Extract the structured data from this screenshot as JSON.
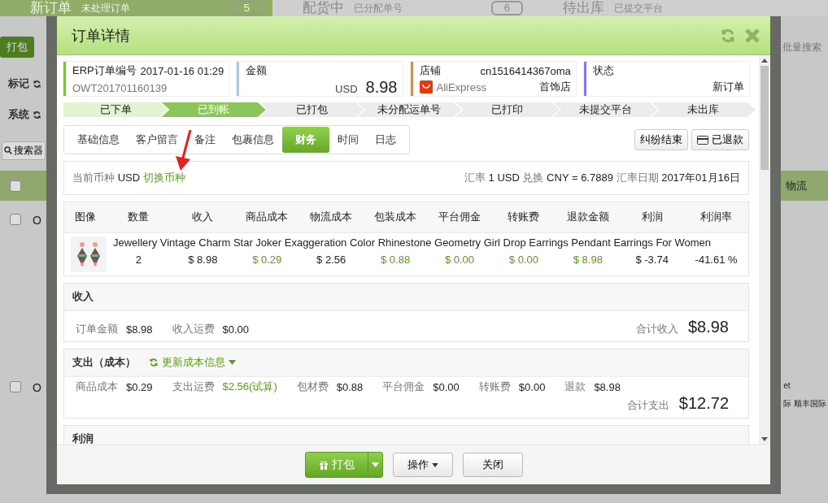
{
  "background": {
    "stats": [
      {
        "title": "新订单",
        "subtitle": "未处理订单",
        "count": "5",
        "selected": true
      },
      {
        "title": "配货中",
        "subtitle": "已分配单号",
        "count": "6",
        "selected": false
      },
      {
        "title": "待出库",
        "subtitle": "已提交平台",
        "selected": false
      }
    ],
    "pack_button": "打包",
    "batch_search": "批量搜索",
    "filters": [
      "标记",
      "系统"
    ],
    "search_button": "搜索器",
    "logistics_header": "物流",
    "header_checked": false,
    "rows": [
      {
        "order": "O",
        "checked": false,
        "logistics": []
      },
      {
        "order": "O",
        "checked": false,
        "logistics": [
          "et",
          "际 顺丰国际"
        ]
      }
    ]
  },
  "dialog": {
    "title": "订单详情",
    "info_cards": [
      {
        "kind": "order",
        "label": "ERP订单编号",
        "value": "2017-01-16 01:29",
        "sub": "OWT201701160139",
        "color": "#7cc04b"
      },
      {
        "kind": "amount",
        "label": "金额",
        "currency": "USD",
        "amount": "8.98",
        "color": "#a9c9e8"
      },
      {
        "kind": "shop",
        "label": "店铺",
        "value": "cn1516414367oma",
        "platform": "AliExpress",
        "sub": "首饰店",
        "color": "#f08a24"
      },
      {
        "kind": "status",
        "label": "状态",
        "sub": "新订单",
        "color": "#8578f0"
      }
    ],
    "steps": [
      {
        "label": "已下单",
        "completed": true,
        "selected": false
      },
      {
        "label": "已到帐",
        "completed": true,
        "selected": true
      },
      {
        "label": "已打包",
        "completed": false,
        "selected": false
      },
      {
        "label": "未分配运单号",
        "completed": false,
        "selected": false
      },
      {
        "label": "已打印",
        "completed": false,
        "selected": false
      },
      {
        "label": "未提交平台",
        "completed": false,
        "selected": false
      },
      {
        "label": "未出库",
        "completed": false,
        "selected": false
      }
    ],
    "tabs": [
      {
        "label": "基础信息",
        "selected": false
      },
      {
        "label": "客户留言",
        "selected": false
      },
      {
        "label": "备注",
        "selected": false
      },
      {
        "label": "包裹信息",
        "selected": false
      },
      {
        "label": "财务",
        "selected": true
      },
      {
        "label": "时间",
        "selected": false
      },
      {
        "label": "日志",
        "selected": false
      }
    ],
    "actions": [
      {
        "label": "纠纷结束",
        "kind": "plain"
      },
      {
        "label": "已退款",
        "kind": "card"
      }
    ],
    "currency": {
      "label": "当前币种",
      "code": "USD",
      "link": "切换币种",
      "rate_label": "汇率",
      "rate": "1 USD",
      "exchange_label": "兑换",
      "exchange": "CNY = 6.7889",
      "date_label": "汇率日期",
      "date": "2017年01月16日"
    },
    "product_table": {
      "columns": [
        "图像",
        "数量",
        "收入",
        "商品成本",
        "物流成本",
        "包装成本",
        "平台佣金",
        "转账费",
        "退款金额",
        "利润",
        "利润率"
      ],
      "row": {
        "name": "Jewellery Vintage Charm Star Joker Exaggeration Color Rhinestone Geometry Girl Drop Earrings Pendant Earrings For Women",
        "cells": [
          {
            "text": "2",
            "kind": "plain"
          },
          {
            "text": "$ 8.98",
            "kind": "plain"
          },
          {
            "text": "$ 0.29",
            "kind": "link"
          },
          {
            "text": "$ 2.56",
            "kind": "plain"
          },
          {
            "text": "$ 0.88",
            "kind": "link"
          },
          {
            "text": "$ 0.00",
            "kind": "link"
          },
          {
            "text": "$ 0.00",
            "kind": "link"
          },
          {
            "text": "$ 8.98",
            "kind": "link"
          },
          {
            "text": "$ -3.74",
            "kind": "plain"
          },
          {
            "text": "-41.61 %",
            "kind": "plain"
          }
        ]
      }
    },
    "income": {
      "title": "收入",
      "items": [
        {
          "label": "订单金额",
          "value": "$8.98"
        },
        {
          "label": "收入运费",
          "value": "$0.00"
        }
      ],
      "total_label": "合计收入",
      "total": "$8.98"
    },
    "expense": {
      "title": "支出（成本）",
      "update_link": "更新成本信息",
      "items": [
        {
          "label": "商品成本",
          "value": "$0.29",
          "kind": "plain"
        },
        {
          "label": "支出运费",
          "value": "$2.56(试算)",
          "kind": "link"
        },
        {
          "label": "包材费",
          "value": "$0.88",
          "kind": "plain"
        },
        {
          "label": "平台佣金",
          "value": "$0.00",
          "kind": "plain"
        },
        {
          "label": "转账费",
          "value": "$0.00",
          "kind": "plain"
        },
        {
          "label": "退款",
          "value": "$8.98",
          "kind": "plain"
        }
      ],
      "total_label": "合计支出",
      "total": "$12.72"
    },
    "profit": {
      "title": "利润"
    },
    "footer": [
      {
        "label": "打包",
        "kind": "primary"
      },
      {
        "label": "操作",
        "kind": "menu"
      },
      {
        "label": "关闭",
        "kind": "plain"
      }
    ]
  }
}
